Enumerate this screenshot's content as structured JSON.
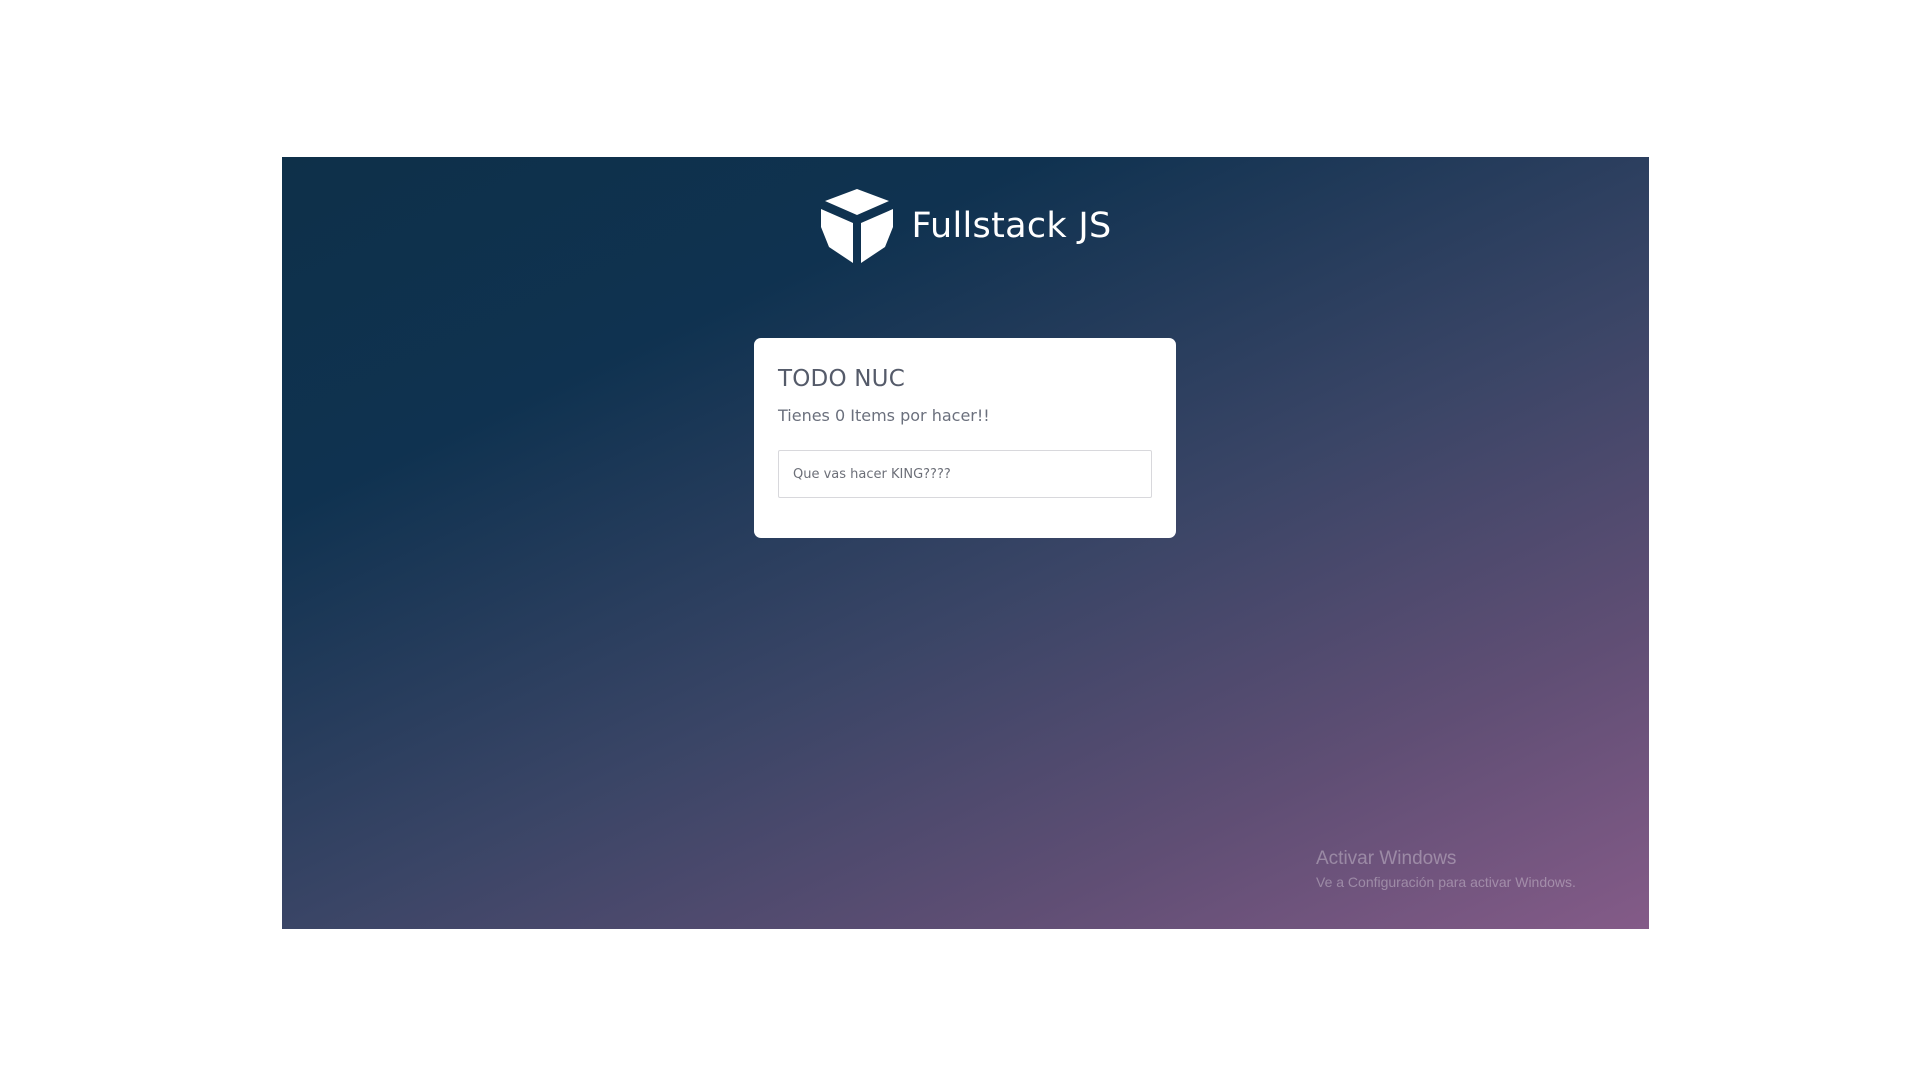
{
  "brand": {
    "title": "Fullstack JS",
    "logo_icon": "cube-logo-icon"
  },
  "todo_card": {
    "title": "TODO NUC",
    "subtitle": "Tienes 0 Items por hacer!!",
    "input": {
      "value": "",
      "placeholder": "Que vas hacer KING????"
    }
  },
  "watermark": {
    "title": "Activar Windows",
    "subtitle": "Ve a Configuración para activar Windows."
  },
  "colors": {
    "gradient_start": "#0e3049",
    "gradient_end": "#845b88",
    "card_background": "#ffffff",
    "title_text": "#555b6a"
  }
}
